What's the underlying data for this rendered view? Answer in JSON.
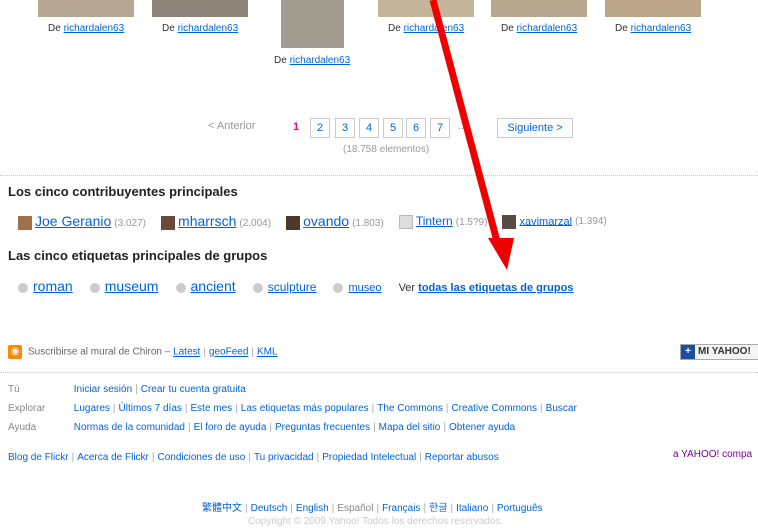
{
  "photos": {
    "by_prefix": "De",
    "owner": "richardalen63"
  },
  "pager": {
    "prev": "< Anterior",
    "pages": [
      "1",
      "2",
      "3",
      "4",
      "5",
      "6",
      "7"
    ],
    "ellipsis": "...",
    "next": "Siguiente >",
    "count": "(18.758 elementos)"
  },
  "contributors": {
    "heading": "Los cinco contribuyentes principales",
    "items": [
      {
        "name": "Joe Geranio",
        "count": "(3.027)"
      },
      {
        "name": "mharrsch",
        "count": "(2.004)"
      },
      {
        "name": "ovando",
        "count": "(1.803)"
      },
      {
        "name": "Tintern",
        "count": "(1.5?9)"
      },
      {
        "name": "xavimarzal",
        "count": "(1.394)"
      }
    ]
  },
  "tags": {
    "heading": "Las cinco etiquetas principales de grupos",
    "items": [
      "roman",
      "museum",
      "ancient",
      "sculpture",
      "museo"
    ],
    "see_all_prefix": "Ver",
    "see_all_link": "todas las etiquetas de grupos"
  },
  "feed": {
    "label": "Suscribirse al mural de Chiron –",
    "links": [
      "Latest",
      "geoFeed",
      "KML"
    ],
    "my_yahoo": "MI YAHOO!"
  },
  "nav": {
    "rows": [
      {
        "label": "Tú",
        "links": [
          "Iniciar sesión",
          "Crear tu cuenta gratuita"
        ]
      },
      {
        "label": "Explorar",
        "links": [
          "Lugares",
          "Últimos 7 días",
          "Este mes",
          "Las etiquetas más populares",
          "The Commons",
          "Creative Commons",
          "Buscar"
        ]
      },
      {
        "label": "Ayuda",
        "links": [
          "Normas de la comunidad",
          "El foro de ayuda",
          "Preguntas frecuentes",
          "Mapa del sitio",
          "Obtener ayuda"
        ]
      }
    ]
  },
  "footer": {
    "links": [
      "Blog de Flickr",
      "Acerca de Flickr",
      "Condiciones de uso",
      "Tu privacidad",
      "Propiedad Intelectual",
      "Reportar abusos"
    ],
    "yahoo": "a YAHOO! compa",
    "languages": [
      "繁體中文",
      "Deutsch",
      "English",
      "Español",
      "Français",
      "한글",
      "Italiano",
      "Português"
    ],
    "current_language": "Español",
    "copyright": "Copyright © 2009 Yahoo! Todos los derechos reservados."
  },
  "colors": {
    "link": "#0063dc",
    "current_page": "#ff0084",
    "arrow": "#ee0000"
  }
}
